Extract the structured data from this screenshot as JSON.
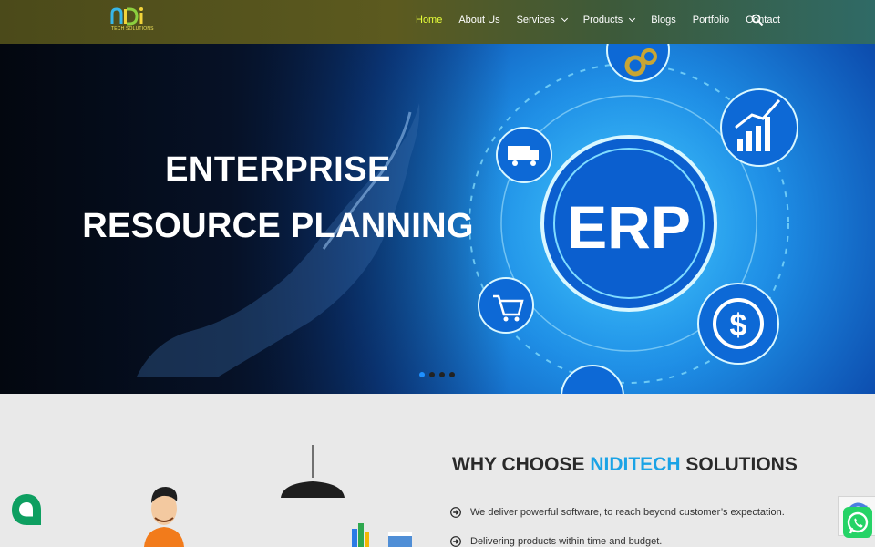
{
  "header": {
    "logo_text": "nDi",
    "logo_sub": "TECH SOLUTIONS",
    "nav": [
      {
        "label": "Home",
        "active": true
      },
      {
        "label": "About Us"
      },
      {
        "label": "Services",
        "dropdown": true
      },
      {
        "label": "Products",
        "dropdown": true
      },
      {
        "label": "Blogs"
      },
      {
        "label": "Portfolio"
      },
      {
        "label": "Contact"
      }
    ],
    "search_icon": "search-icon"
  },
  "hero": {
    "title_line1": "ENTERPRISE",
    "title_line2": "RESOURCE PLANNING",
    "graphic_label": "ERP",
    "slides": 4,
    "active_slide": 1
  },
  "why": {
    "title_prefix": "WHY CHOOSE",
    "title_accent": "NIDITECH",
    "title_suffix": "SOLUTIONS",
    "points": [
      "We deliver powerful software, to reach beyond customer’s expectation.",
      "Delivering products within time and budget."
    ]
  },
  "colors": {
    "accent_blue": "#1aa3e6",
    "nav_active": "#e7ff3a",
    "chat_green": "#0e9f61",
    "whatsapp_green": "#25d366"
  }
}
